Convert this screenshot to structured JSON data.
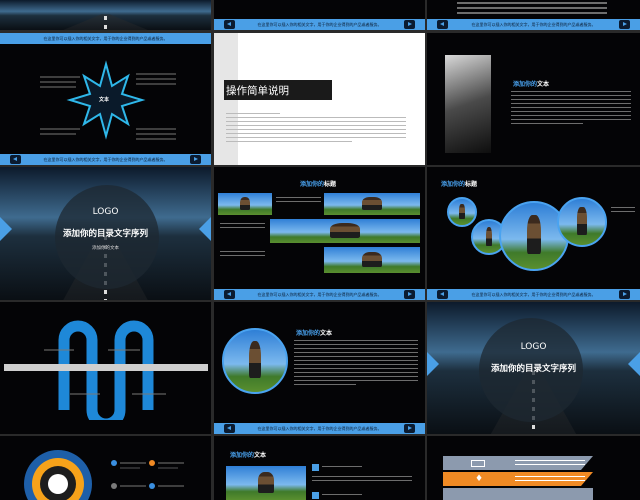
{
  "footer_text": "在这里你可以插入你的相关文字，用于你的企业得到的产品或者服务。",
  "s5": {
    "title": "操作简单说明"
  },
  "s4": {
    "center_label": "文本"
  },
  "s6": {
    "title_accent": "添加你的",
    "title_rest": "文本"
  },
  "s7": {
    "logo": "LOGO",
    "title": "添加你的目录文字序列",
    "subtitle": "添加你的文本"
  },
  "s8": {
    "title_accent": "添加你的",
    "title_rest": "标题"
  },
  "s9": {
    "title_accent": "添加你的",
    "title_rest": "标题"
  },
  "s11": {
    "title_accent": "添加你的",
    "title_rest": "文本"
  },
  "s12": {
    "logo": "LOGO",
    "title": "添加你的目录文字序列"
  },
  "s14": {
    "title_accent": "添加你的",
    "title_rest": "文本"
  },
  "colors": {
    "accent": "#4a9fe6",
    "dark": "#040406"
  }
}
